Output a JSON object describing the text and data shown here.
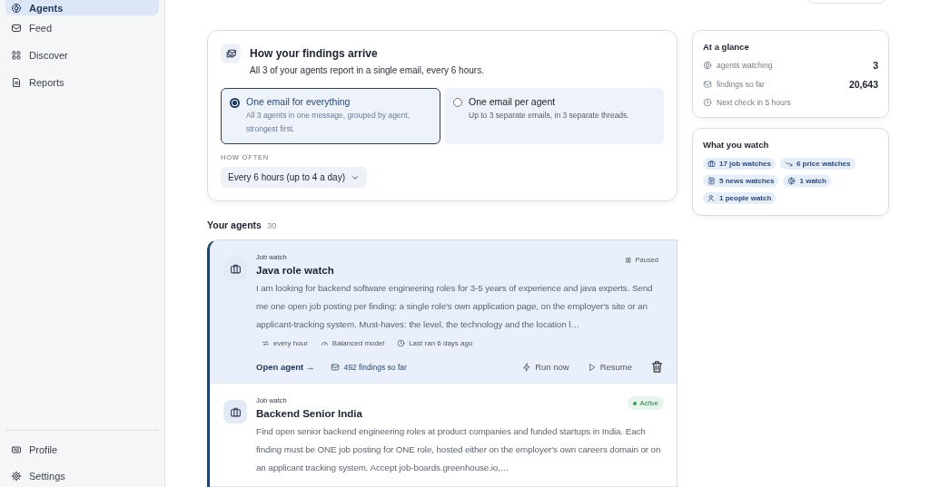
{
  "sidebar": {
    "items": [
      {
        "label": "Agents",
        "selected": true
      },
      {
        "label": "Feed",
        "selected": false
      },
      {
        "label": "Discover",
        "selected": false
      },
      {
        "label": "Reports",
        "selected": false
      }
    ],
    "footer_items": [
      {
        "label": "Profile",
        "selected": false
      },
      {
        "label": "Settings",
        "selected": false
      }
    ]
  },
  "delivery": {
    "title": "How your findings arrive",
    "subtitle": "All 3 of your agents report in a single email, every 6 hours.",
    "options": [
      {
        "title": "One email for everything",
        "description": "All 3 agents in one message, grouped by agent, strongest first.",
        "selected": true
      },
      {
        "title": "One email per agent",
        "description": "Up to 3 separate emails, in 3 separate threads.",
        "selected": false
      }
    ],
    "frequency": {
      "label": "HOW OFTEN",
      "value": "Every 6 hours (up to 4 a day)"
    }
  },
  "glance": {
    "title": "At a glance",
    "stats": [
      {
        "label": "agents watching",
        "value": "3"
      },
      {
        "label": "findings so far",
        "value": "20,643"
      }
    ],
    "next_check": "Next check in 5 hours"
  },
  "watch": {
    "title": "What you watch",
    "tags": [
      {
        "label": "17 job watches"
      },
      {
        "label": "6 price watches"
      },
      {
        "label": "5 news watches"
      },
      {
        "label": "1 watch"
      },
      {
        "label": "1 people watch"
      }
    ]
  },
  "agents": {
    "title": "Your agents",
    "count": "30",
    "items": [
      {
        "type": "Job watch",
        "name": "Java role watch",
        "paused": true,
        "status_label": "Paused",
        "selected": true,
        "description": "I am looking for backend software engineering roles for 3-5 years of experience and java experts. Send me one open job posting per finding: a single role's own application page, on the employer's site or an applicant-tracking system. Must-haves: the level, the technology and the location l…",
        "meta": [
          "every hour",
          "Balanced model",
          "Last ran 6 days ago"
        ],
        "open_label": "Open agent →",
        "findings": "492 findings so far",
        "actions": [
          "Run now",
          "Resume"
        ]
      },
      {
        "type": "Job watch",
        "name": "Backend Senior India",
        "paused": false,
        "status_label": "Active",
        "selected": false,
        "description": "Find open senior backend engineering roles at product companies and funded startups in India. Each finding must be ONE job posting for ONE role, hosted either on the employer's own careers domain or on an applicant tracking system. Accept job-boards.greenhouse.io,…"
      }
    ]
  }
}
